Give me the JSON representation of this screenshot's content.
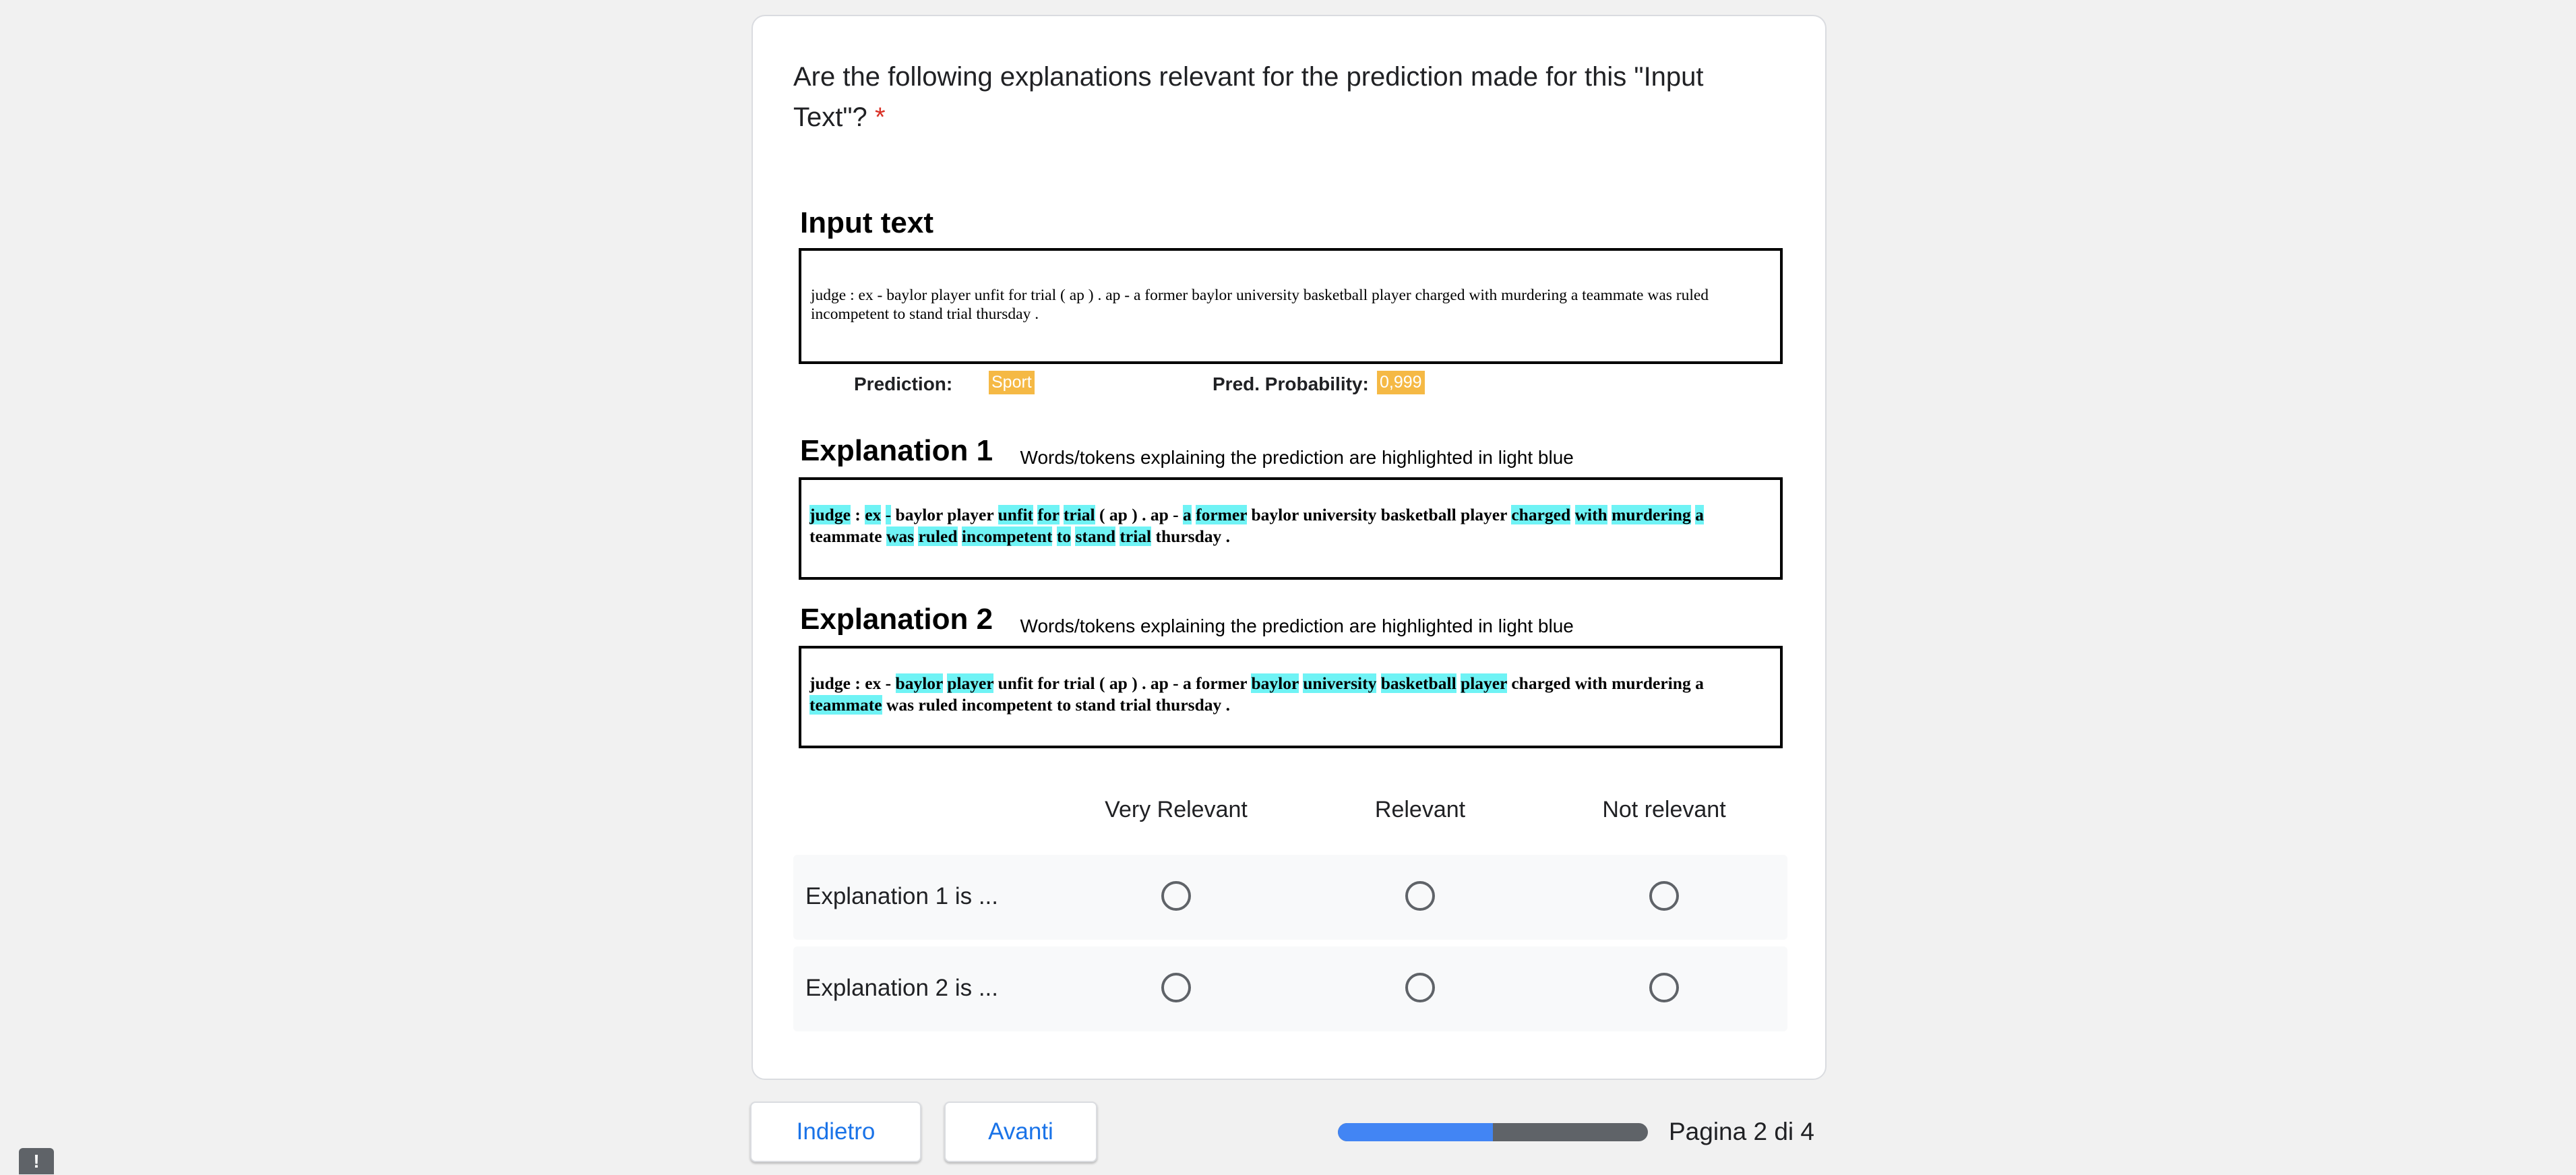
{
  "question": {
    "text": "Are the following explanations relevant for the prediction made for this \"Input Text\"?",
    "required_mark": "*"
  },
  "figure": {
    "input_heading": "Input text",
    "input_text": "judge : ex - baylor player unfit for trial ( ap ) . ap - a former baylor university basketball player charged with murdering a teammate was ruled incompetent to stand trial thursday .",
    "prediction_label": "Prediction:",
    "prediction_value": "Sport",
    "probability_label": "Pred. Probability:",
    "probability_value": "0,999",
    "explanations": [
      {
        "title": "Explanation 1",
        "subtitle": "Words/tokens explaining the prediction are highlighted in light blue",
        "tokens": [
          {
            "t": "judge",
            "h": true
          },
          {
            "t": ":",
            "h": false
          },
          {
            "t": "ex",
            "h": true
          },
          {
            "t": "-",
            "h": true
          },
          {
            "t": "baylor",
            "h": false
          },
          {
            "t": "player",
            "h": false
          },
          {
            "t": "unfit",
            "h": true
          },
          {
            "t": "for",
            "h": true
          },
          {
            "t": "trial",
            "h": true
          },
          {
            "t": "(",
            "h": false
          },
          {
            "t": "ap",
            "h": false
          },
          {
            "t": ")",
            "h": false
          },
          {
            "t": ".",
            "h": false
          },
          {
            "t": "ap",
            "h": false
          },
          {
            "t": "-",
            "h": false
          },
          {
            "t": "a",
            "h": true
          },
          {
            "t": "former",
            "h": true
          },
          {
            "t": "baylor",
            "h": false
          },
          {
            "t": "university",
            "h": false
          },
          {
            "t": "basketball",
            "h": false
          },
          {
            "t": "player",
            "h": false
          },
          {
            "t": "charged",
            "h": true
          },
          {
            "t": "with",
            "h": true
          },
          {
            "t": "murdering",
            "h": true
          },
          {
            "t": "a",
            "h": true
          },
          {
            "t": "teammate",
            "h": false
          },
          {
            "t": "was",
            "h": true
          },
          {
            "t": "ruled",
            "h": true
          },
          {
            "t": "incompetent",
            "h": true
          },
          {
            "t": "to",
            "h": true
          },
          {
            "t": "stand",
            "h": true
          },
          {
            "t": "trial",
            "h": true
          },
          {
            "t": "thursday",
            "h": false
          },
          {
            "t": ".",
            "h": false
          }
        ]
      },
      {
        "title": "Explanation 2",
        "subtitle": "Words/tokens explaining the prediction are highlighted in light blue",
        "tokens": [
          {
            "t": "judge",
            "h": false
          },
          {
            "t": ":",
            "h": false
          },
          {
            "t": "ex",
            "h": false
          },
          {
            "t": "-",
            "h": false
          },
          {
            "t": "baylor",
            "h": true
          },
          {
            "t": "player",
            "h": true
          },
          {
            "t": "unfit",
            "h": false
          },
          {
            "t": "for",
            "h": false
          },
          {
            "t": "trial",
            "h": false
          },
          {
            "t": "(",
            "h": false
          },
          {
            "t": "ap",
            "h": false
          },
          {
            "t": ")",
            "h": false
          },
          {
            "t": ".",
            "h": false
          },
          {
            "t": "ap",
            "h": false
          },
          {
            "t": "-",
            "h": false
          },
          {
            "t": "a",
            "h": false
          },
          {
            "t": "former",
            "h": false
          },
          {
            "t": "baylor",
            "h": true
          },
          {
            "t": "university",
            "h": true
          },
          {
            "t": "basketball",
            "h": true
          },
          {
            "t": "player",
            "h": true
          },
          {
            "t": "charged",
            "h": false
          },
          {
            "t": "with",
            "h": false
          },
          {
            "t": "murdering",
            "h": false
          },
          {
            "t": "a",
            "h": false
          },
          {
            "t": "teammate",
            "h": true
          },
          {
            "t": "was",
            "h": false
          },
          {
            "t": "ruled",
            "h": false
          },
          {
            "t": "incompetent",
            "h": false
          },
          {
            "t": "to",
            "h": false
          },
          {
            "t": "stand",
            "h": false
          },
          {
            "t": "trial",
            "h": false
          },
          {
            "t": "thursday",
            "h": false
          },
          {
            "t": ".",
            "h": false
          }
        ]
      }
    ]
  },
  "grid": {
    "columns": [
      "Very Relevant",
      "Relevant",
      "Not relevant"
    ],
    "rows": [
      "Explanation 1 is ...",
      "Explanation 2 is ..."
    ]
  },
  "nav": {
    "back_label": "Indietro",
    "next_label": "Avanti",
    "progress_fraction": 0.5,
    "page_label": "Pagina 2 di 4"
  },
  "report_label": "!",
  "colors": {
    "highlight": "#6ff3f5",
    "badge": "#f5b945",
    "accent": "#1a73e8",
    "progress_fill": "#4285f4",
    "required": "#d93025"
  }
}
